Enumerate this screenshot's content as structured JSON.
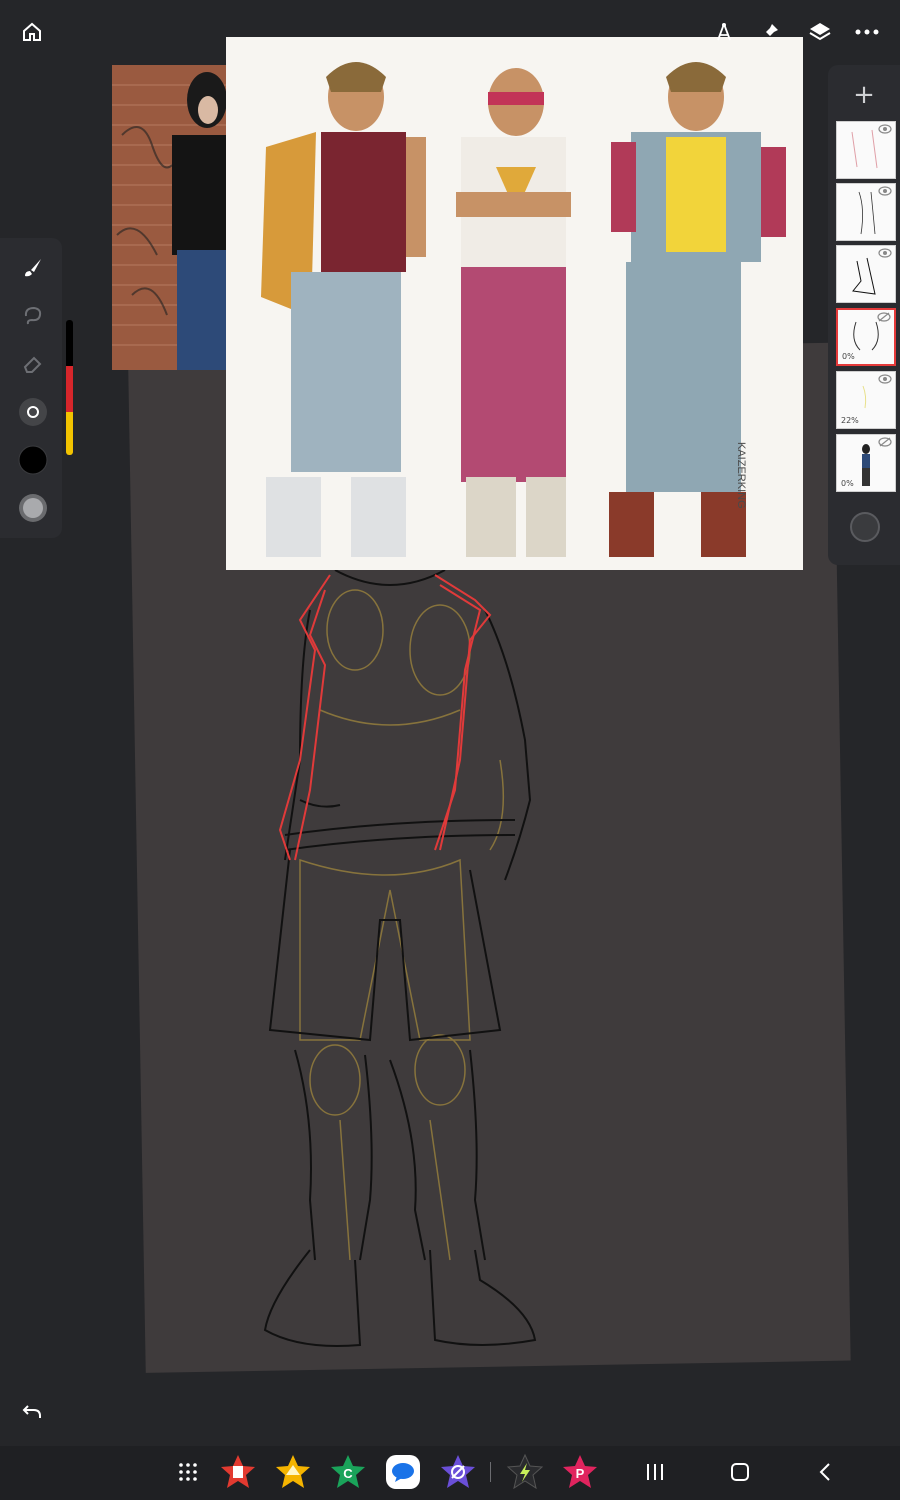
{
  "toolbar": {
    "home_icon": "home-icon",
    "ruler_icon": "ruler-icon",
    "pin_icon": "pin-icon",
    "layers_icon": "layers-icon",
    "more_icon": "more-icon"
  },
  "reference_art": {
    "signature": "KAIZERKING"
  },
  "tools": [
    "brush-icon",
    "lasso-icon",
    "eraser-icon",
    "brush-size-icon",
    "color-swatch",
    "opacity-swatch"
  ],
  "colors": {
    "primary": "#000000",
    "slider_gradient": [
      "#000000",
      "#d7262b",
      "#f2c300"
    ]
  },
  "layers": {
    "add_label": "+",
    "items": [
      {
        "name": "layer-1",
        "opacity": "",
        "visible": true,
        "selected": false
      },
      {
        "name": "layer-2",
        "opacity": "",
        "visible": true,
        "selected": false
      },
      {
        "name": "layer-3",
        "opacity": "",
        "visible": true,
        "selected": false
      },
      {
        "name": "layer-4",
        "opacity": "0%",
        "visible": false,
        "selected": true
      },
      {
        "name": "layer-5",
        "opacity": "22%",
        "visible": true,
        "selected": false
      },
      {
        "name": "layer-6",
        "opacity": "0%",
        "visible": false,
        "selected": false
      }
    ]
  },
  "taskbar": {
    "apps": [
      "apps-grid-icon",
      "app-red-star-icon",
      "app-yellow-star-icon",
      "app-green-star-icon",
      "messages-app-icon",
      "app-purple-star-icon",
      "app-dark-star-icon",
      "pinterest-app-icon"
    ],
    "nav": [
      "recents-icon",
      "home-nav-icon",
      "back-icon"
    ]
  }
}
